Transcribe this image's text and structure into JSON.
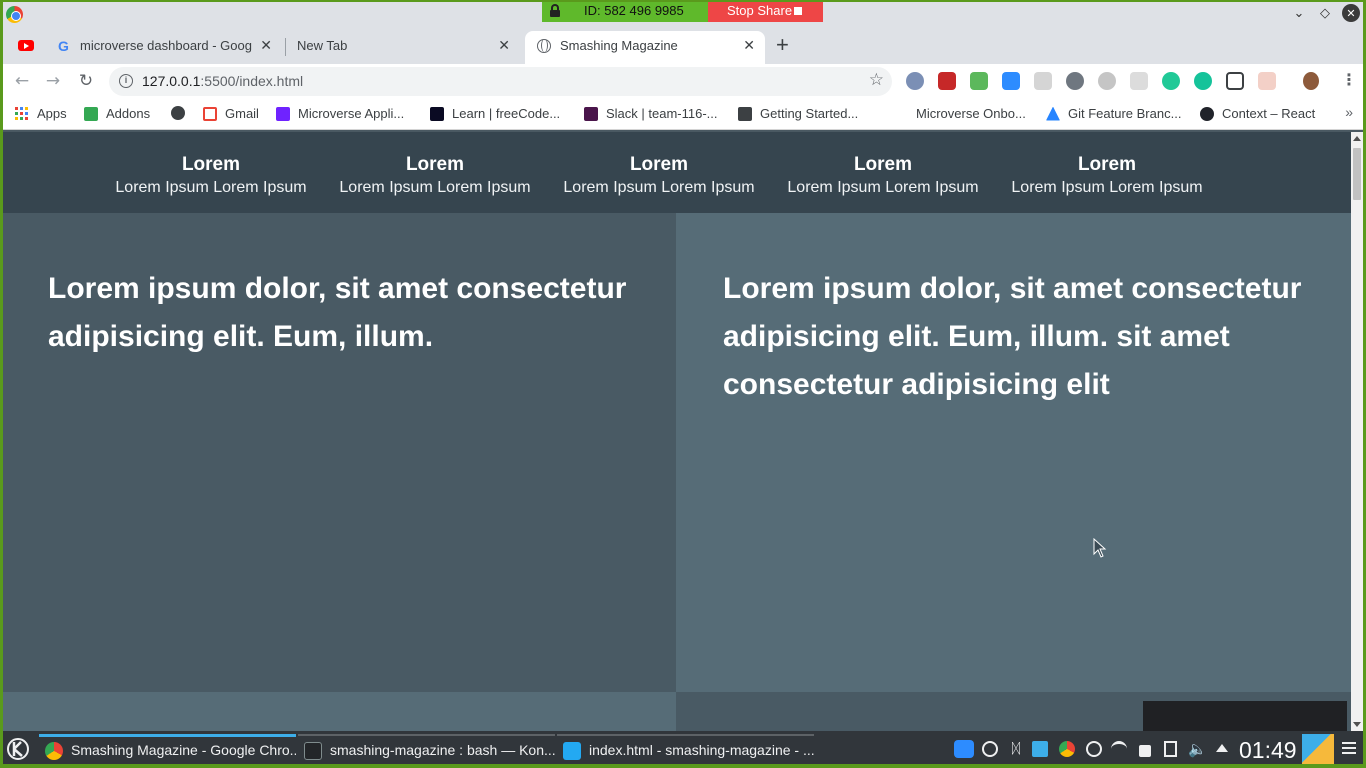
{
  "screen_share": {
    "id_label": "ID: 582 496 9985",
    "stop_label": "Stop Share"
  },
  "tabs": [
    {
      "title": "",
      "icon": "youtube-icon"
    },
    {
      "title": "microverse dashboard - Goog",
      "icon": "google-icon"
    },
    {
      "title": "New Tab",
      "icon": ""
    },
    {
      "title": "Smashing Magazine",
      "icon": "globe-icon",
      "active": true
    }
  ],
  "toolbar": {
    "url_host": "127.0.0.1",
    "url_path": ":5500/index.html"
  },
  "bookmarks": [
    {
      "label": "Apps",
      "icon": "apps-grid-icon"
    },
    {
      "label": "Addons",
      "icon": "puzzle-icon"
    },
    {
      "label": "",
      "icon": "globe-icon"
    },
    {
      "label": "Gmail",
      "icon": "gmail-icon"
    },
    {
      "label": "Microverse Appli...",
      "icon": "microverse-icon"
    },
    {
      "label": "Learn | freeCode...",
      "icon": "freecodecamp-icon"
    },
    {
      "label": "Slack | team-116-...",
      "icon": "slack-icon"
    },
    {
      "label": "Getting Started...",
      "icon": "floppy-icon"
    },
    {
      "label": "Microverse Onbo...",
      "icon": ""
    },
    {
      "label": "Git Feature Branc...",
      "icon": "atlassian-icon"
    },
    {
      "label": "Context – React",
      "icon": "react-icon"
    }
  ],
  "site_nav": [
    {
      "title": "Lorem",
      "sub": "Lorem Ipsum Lorem Ipsum"
    },
    {
      "title": "Lorem",
      "sub": "Lorem Ipsum Lorem Ipsum"
    },
    {
      "title": "Lorem",
      "sub": "Lorem Ipsum Lorem Ipsum"
    },
    {
      "title": "Lorem",
      "sub": "Lorem Ipsum Lorem Ipsum"
    },
    {
      "title": "Lorem",
      "sub": "Lorem Ipsum Lorem Ipsum"
    }
  ],
  "hero": {
    "left": "Lorem ipsum dolor, sit amet consectetur adipisicing elit. Eum, illum.",
    "right": "Lorem ipsum dolor, sit amet consectetur adipisicing elit. Eum, illum. sit amet consectetur adipisicing elit"
  },
  "taskbar": {
    "tasks": [
      {
        "label": "Smashing Magazine - Google Chro...",
        "icon": "chrome-icon",
        "active": true
      },
      {
        "label": "smashing-magazine : bash — Kon...",
        "icon": "konsole-icon"
      },
      {
        "label": "index.html - smashing-magazine - ...",
        "icon": "vscode-icon"
      }
    ],
    "clock": "01:49"
  },
  "colors": {
    "share_green": "#5fb92b",
    "share_red": "#ee4646",
    "nav_bg": "#36454f",
    "left_col": "#495a64",
    "right_col": "#566c77",
    "taskbar_bg": "#31363b"
  }
}
